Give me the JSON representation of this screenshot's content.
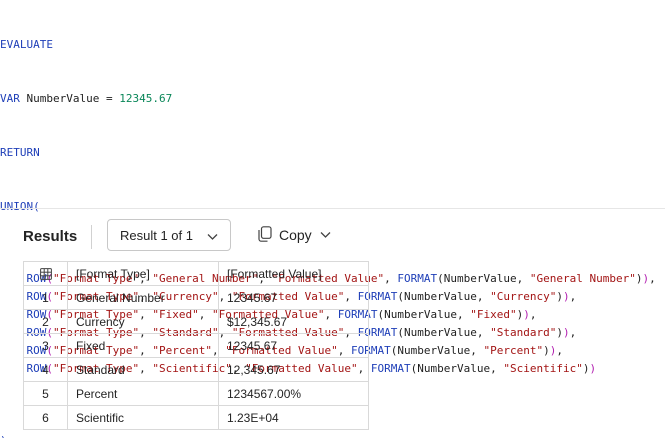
{
  "code": {
    "evaluate": "EVALUATE",
    "var_kw": "VAR",
    "var_name": "NumberValue",
    "equals": " = ",
    "var_value": "12345.67",
    "return_kw": "RETURN",
    "union_fn": "UNION",
    "open_paren": "(",
    "close_paren": ")",
    "row_fn": "ROW",
    "format_fn": "FORMAT",
    "col1_name": "\"Format Type\"",
    "col2_name": "\"Formatted Value\"",
    "rows": [
      {
        "label": "\"General Number\"",
        "fmt": "\"General Number\""
      },
      {
        "label": "\"Currency\"",
        "fmt": "\"Currency\""
      },
      {
        "label": "\"Fixed\"",
        "fmt": "\"Fixed\""
      },
      {
        "label": "\"Standard\"",
        "fmt": "\"Standard\""
      },
      {
        "label": "\"Percent\"",
        "fmt": "\"Percent\""
      },
      {
        "label": "\"Scientific\"",
        "fmt": "\"Scientific\""
      }
    ]
  },
  "results": {
    "title": "Results",
    "selector_label": "Result 1 of 1",
    "copy_label": "Copy"
  },
  "table": {
    "headers": [
      "[Format Type]",
      "[Formatted Value]"
    ],
    "rows": [
      {
        "n": "1",
        "type": "General Number",
        "value": "12345.67"
      },
      {
        "n": "2",
        "type": "Currency",
        "value": "$12,345.67"
      },
      {
        "n": "3",
        "type": "Fixed",
        "value": "12345.67"
      },
      {
        "n": "4",
        "type": "Standard",
        "value": "12,345.67"
      },
      {
        "n": "5",
        "type": "Percent",
        "value": "1234567.00%"
      },
      {
        "n": "6",
        "type": "Scientific",
        "value": "1.23E+04"
      }
    ]
  }
}
